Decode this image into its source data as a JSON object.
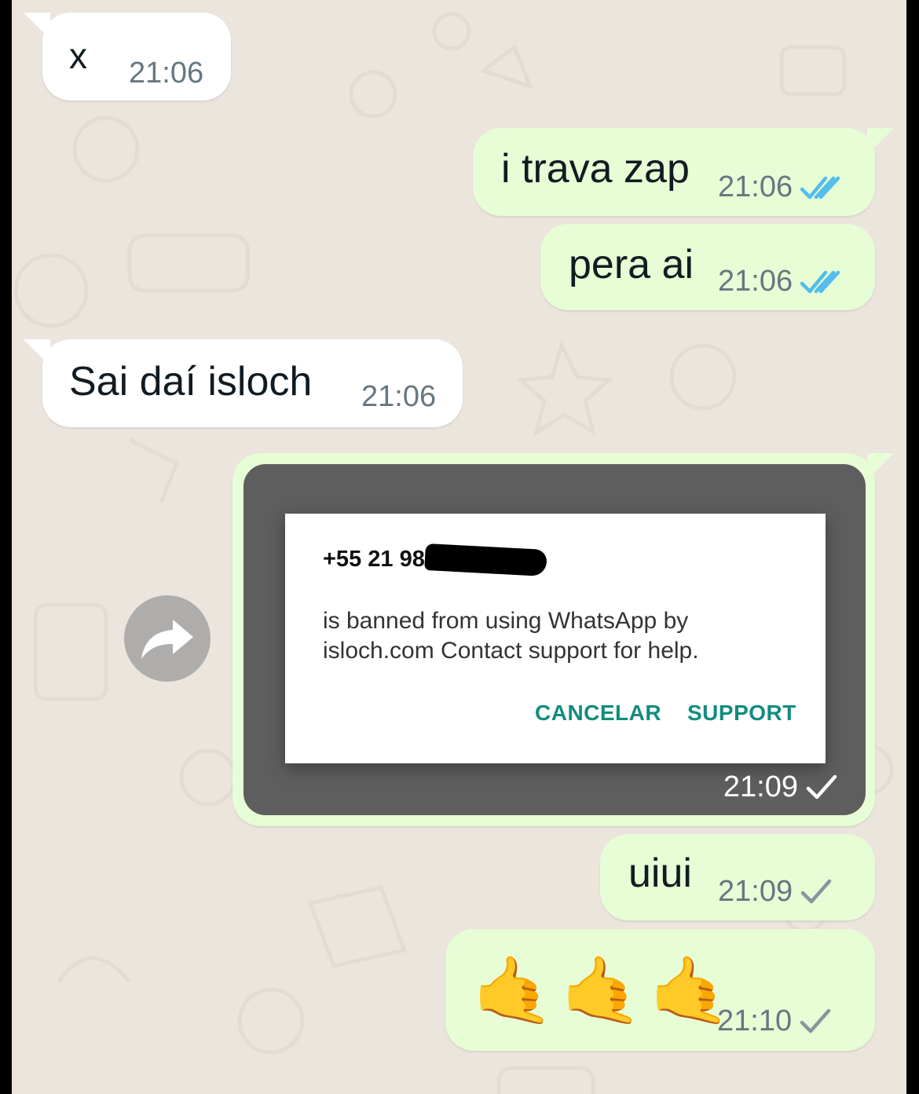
{
  "messages": [
    {
      "id": "m1",
      "direction": "incoming",
      "text": "x",
      "time": "21:06"
    },
    {
      "id": "m2",
      "direction": "outgoing",
      "text": "i trava zap",
      "time": "21:06",
      "status": "read"
    },
    {
      "id": "m3",
      "direction": "outgoing",
      "text": "pera ai",
      "time": "21:06",
      "status": "read"
    },
    {
      "id": "m4",
      "direction": "incoming",
      "text": "Sai daí isloch",
      "time": "21:06"
    },
    {
      "id": "m5",
      "direction": "outgoing",
      "type": "image",
      "time": "21:09",
      "status": "sent",
      "image": {
        "phone_visible": "+55 21 98",
        "body": "is banned from using WhatsApp by isloch.com Contact support for help.",
        "cancel_label": "CANCELAR",
        "support_label": "SUPPORT"
      }
    },
    {
      "id": "m6",
      "direction": "outgoing",
      "text": "uiui",
      "time": "21:09",
      "status": "sent"
    },
    {
      "id": "m7",
      "direction": "outgoing",
      "text": "🤙🤙🤙",
      "emojis": [
        "🤙",
        "🤙",
        "🤙"
      ],
      "time": "21:10",
      "status": "sent"
    }
  ],
  "icons": {
    "forward": "forward-arrow-icon",
    "read": "double-check-icon",
    "sent": "single-check-icon"
  },
  "colors": {
    "chat_background": "#ebe5de",
    "incoming_bubble": "#ffffff",
    "outgoing_bubble": "#e7fdd5",
    "read_tick": "#53bdeb",
    "sent_tick": "#8696a0",
    "dialog_button": "#128c7e"
  }
}
